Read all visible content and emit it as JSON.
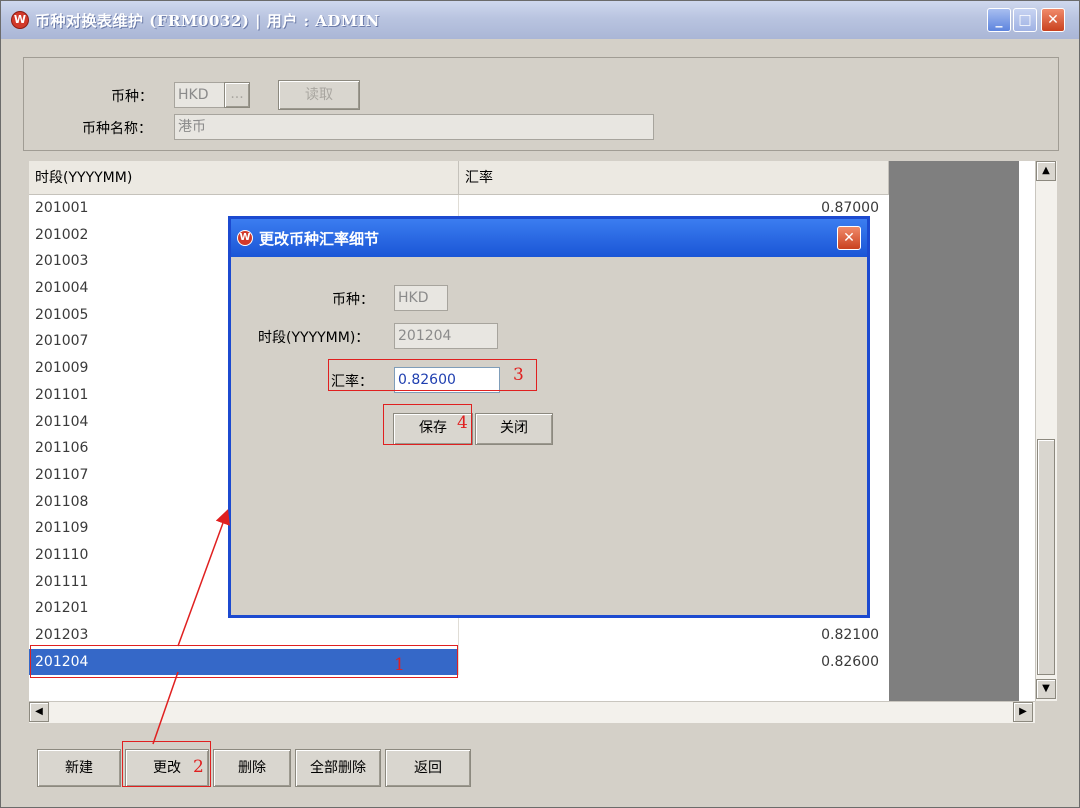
{
  "window": {
    "title": "币种对换表维护  (FRM0032)  |  用户  :  ADMIN",
    "min_label": "_",
    "max_label": "□",
    "close_label": "✕"
  },
  "header": {
    "currency_label": "币种：",
    "currency_value": "HKD",
    "browse_label": "...",
    "read_label": "读取",
    "currency_name_label": "币种名称：",
    "currency_name_value": "港币"
  },
  "table": {
    "columns": [
      "时段(YYYYMM)",
      "汇率"
    ],
    "rows": [
      {
        "period": "201001",
        "rate": "0.87000"
      },
      {
        "period": "201002",
        "rate": ""
      },
      {
        "period": "201003",
        "rate": ""
      },
      {
        "period": "201004",
        "rate": ""
      },
      {
        "period": "201005",
        "rate": ""
      },
      {
        "period": "201007",
        "rate": ""
      },
      {
        "period": "201009",
        "rate": ""
      },
      {
        "period": "201101",
        "rate": ""
      },
      {
        "period": "201104",
        "rate": ""
      },
      {
        "period": "201106",
        "rate": ""
      },
      {
        "period": "201107",
        "rate": ""
      },
      {
        "period": "201108",
        "rate": ""
      },
      {
        "period": "201109",
        "rate": ""
      },
      {
        "period": "201110",
        "rate": ""
      },
      {
        "period": "201111",
        "rate": ""
      },
      {
        "period": "201201",
        "rate": ""
      },
      {
        "period": "201203",
        "rate": "0.82100"
      },
      {
        "period": "201204",
        "rate": "0.82600"
      }
    ],
    "selected_period": "201204"
  },
  "dialog": {
    "title": "更改币种汇率细节",
    "close_label": "✕",
    "currency_label": "币种：",
    "currency_value": "HKD",
    "period_label": "时段(YYYYMM)：",
    "period_value": "201204",
    "rate_label": "汇率：",
    "rate_value": "0.82600",
    "save_label": "保存",
    "close_button_label": "关闭"
  },
  "footer": {
    "new_label": "新建",
    "edit_label": "更改",
    "delete_label": "删除",
    "delete_all_label": "全部删除",
    "back_label": "返回"
  },
  "annotations": {
    "step1": "1",
    "step2": "2",
    "step3": "3",
    "step4": "4",
    "color": "#e02020"
  }
}
